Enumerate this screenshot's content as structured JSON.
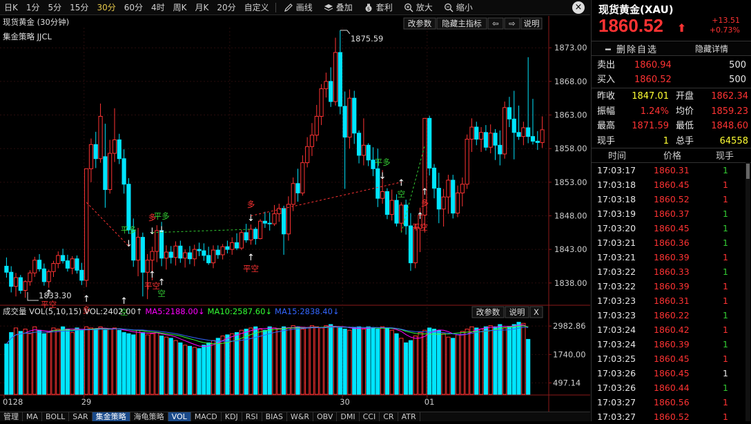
{
  "toolbar": {
    "periods": [
      "日K",
      "1分",
      "5分",
      "15分",
      "30分",
      "60分",
      "4时",
      "周K",
      "月K",
      "20分",
      "自定义"
    ],
    "active_period": "30分",
    "tools": [
      {
        "icon": "pencil-icon",
        "label": "画线"
      },
      {
        "icon": "layers-icon",
        "label": "叠加"
      },
      {
        "icon": "moneybag-icon",
        "label": "套利"
      },
      {
        "icon": "zoom-in-icon",
        "label": "放大"
      },
      {
        "icon": "zoom-out-icon",
        "label": "缩小"
      }
    ],
    "close": "×"
  },
  "main_chart": {
    "title": "现货黄金 (30分钟)",
    "indicator": "集金策略 JJCL",
    "buttons": [
      "改参数",
      "隐藏主指标",
      "⇦",
      "⇨",
      "说明"
    ],
    "high_label": "1875.59",
    "low_label": "1833.30"
  },
  "volume_panel": {
    "legend_prefix": "成交量 VOL(5,10,15)",
    "vol": "VOL:2402.00↑",
    "ma5": "MA5:2188.00↓",
    "ma10": "MA10:2587.60↓",
    "ma15": "MA15:2838.40↓",
    "buttons": [
      "改参数",
      "说明",
      "X"
    ]
  },
  "date_axis": [
    "0128",
    "29",
    "30",
    "01"
  ],
  "bottom_tabs": [
    "管理",
    "MA",
    "BOLL",
    "SAR",
    "集金策略",
    "海龟策略",
    "VOL",
    "MACD",
    "KDJ",
    "RSI",
    "BIAS",
    "W&R",
    "OBV",
    "DMI",
    "CCI",
    "CR",
    "ATR"
  ],
  "bottom_tabs_active": [
    "集金策略",
    "VOL"
  ],
  "colors": {
    "up": "#ff3333",
    "down": "#00e5ff",
    "ma5": "#ff00ff",
    "ma10": "#33ff33",
    "ma15": "#3366ff",
    "signal_buy": "#33cc33",
    "signal_sell": "#ff3333"
  },
  "quote": {
    "title": "现货黄金(XAU)",
    "price": "1860.52",
    "change": "+13.51",
    "change_pct": "+0.73%",
    "btn_delete": "删除自选",
    "btn_hide": "隐藏详情",
    "bid_label": "卖出",
    "bid": "1860.94",
    "bid_vol": "500",
    "ask_label": "买入",
    "ask": "1860.52",
    "ask_vol": "500",
    "stats": [
      {
        "l1": "昨收",
        "v1": "1847.01",
        "l2": "开盘",
        "v2": "1862.34"
      },
      {
        "l1": "振幅",
        "v1": "1.24%",
        "l2": "均价",
        "v2": "1859.23"
      },
      {
        "l1": "最高",
        "v1": "1871.59",
        "l2": "最低",
        "v2": "1848.60"
      },
      {
        "l1": "现手",
        "v1": "1",
        "l2": "总手",
        "v2": "64558"
      }
    ],
    "tick_headers": [
      "时间",
      "价格",
      "现手"
    ],
    "ticks": [
      {
        "t": "17:03:17",
        "p": "1860.31",
        "v": "1",
        "c": "green"
      },
      {
        "t": "17:03:18",
        "p": "1860.45",
        "v": "1",
        "c": "red"
      },
      {
        "t": "17:03:18",
        "p": "1860.52",
        "v": "1",
        "c": "red"
      },
      {
        "t": "17:03:19",
        "p": "1860.37",
        "v": "1",
        "c": "green"
      },
      {
        "t": "17:03:20",
        "p": "1860.45",
        "v": "1",
        "c": "green"
      },
      {
        "t": "17:03:21",
        "p": "1860.36",
        "v": "1",
        "c": "green"
      },
      {
        "t": "17:03:21",
        "p": "1860.39",
        "v": "1",
        "c": "red"
      },
      {
        "t": "17:03:22",
        "p": "1860.33",
        "v": "1",
        "c": "green"
      },
      {
        "t": "17:03:22",
        "p": "1860.39",
        "v": "1",
        "c": "red"
      },
      {
        "t": "17:03:23",
        "p": "1860.31",
        "v": "1",
        "c": "red"
      },
      {
        "t": "17:03:23",
        "p": "1860.22",
        "v": "1",
        "c": "green"
      },
      {
        "t": "17:03:24",
        "p": "1860.42",
        "v": "1",
        "c": "red"
      },
      {
        "t": "17:03:24",
        "p": "1860.39",
        "v": "1",
        "c": "green"
      },
      {
        "t": "17:03:25",
        "p": "1860.45",
        "v": "1",
        "c": "red"
      },
      {
        "t": "17:03:26",
        "p": "1860.45",
        "v": "1",
        "c": "white"
      },
      {
        "t": "17:03:26",
        "p": "1860.44",
        "v": "1",
        "c": "green"
      },
      {
        "t": "17:03:27",
        "p": "1860.56",
        "v": "1",
        "c": "red"
      },
      {
        "t": "17:03:27",
        "p": "1860.52",
        "v": "1",
        "c": "red"
      }
    ]
  },
  "chart_data": [
    {
      "type": "candlestick",
      "title": "现货黄金 (30分钟)",
      "ylim": [
        1835,
        1876
      ],
      "yticks": [
        1838.0,
        1843.0,
        1848.0,
        1853.0,
        1858.0,
        1863.0,
        1868.0,
        1873.0
      ],
      "ohlc": [
        [
          1840.5,
          1841.8,
          1838.8,
          1839.6
        ],
        [
          1839.6,
          1840.5,
          1836.6,
          1837.5
        ],
        [
          1837.5,
          1839.5,
          1836.0,
          1838.8
        ],
        [
          1838.8,
          1839.2,
          1836.4,
          1836.9
        ],
        [
          1836.9,
          1838.4,
          1835.8,
          1838.2
        ],
        [
          1838.2,
          1839.9,
          1837.6,
          1839.5
        ],
        [
          1839.5,
          1841.9,
          1838.9,
          1841.4
        ],
        [
          1841.4,
          1842.3,
          1839.7,
          1840.1
        ],
        [
          1840.1,
          1840.9,
          1837.6,
          1838.2
        ],
        [
          1838.2,
          1840.0,
          1837.3,
          1839.7
        ],
        [
          1839.7,
          1841.3,
          1838.9,
          1840.9
        ],
        [
          1840.9,
          1842.7,
          1840.2,
          1842.1
        ],
        [
          1842.1,
          1843.1,
          1840.9,
          1841.3
        ],
        [
          1841.3,
          1842.2,
          1839.7,
          1840.2
        ],
        [
          1840.2,
          1842.0,
          1839.3,
          1841.6
        ],
        [
          1841.6,
          1842.1,
          1839.4,
          1839.9
        ],
        [
          1839.9,
          1841.0,
          1837.7,
          1838.4
        ],
        [
          1838.4,
          1848.0,
          1837.4,
          1855.0
        ],
        [
          1855.0,
          1859.5,
          1853.0,
          1858.6
        ],
        [
          1858.6,
          1860.5,
          1855.1,
          1856.5
        ],
        [
          1856.5,
          1864.7,
          1855.9,
          1862.8
        ],
        [
          1856.8,
          1861.7,
          1849.2,
          1851.9
        ],
        [
          1851.9,
          1859.3,
          1851.3,
          1857.3
        ],
        [
          1857.3,
          1864.0,
          1856.0,
          1859.3
        ],
        [
          1859.3,
          1860.2,
          1855.7,
          1856.5
        ],
        [
          1856.5,
          1857.9,
          1851.3,
          1852.7
        ],
        [
          1852.7,
          1853.6,
          1845.3,
          1845.9
        ],
        [
          1845.9,
          1847.6,
          1840.4,
          1841.4
        ],
        [
          1841.4,
          1846.2,
          1839.0,
          1844.8
        ],
        [
          1844.8,
          1845.5,
          1836.0,
          1839.6
        ],
        [
          1839.6,
          1842.3,
          1835.6,
          1841.4
        ],
        [
          1841.4,
          1843.4,
          1838.4,
          1842.7
        ],
        [
          1842.7,
          1846.6,
          1841.1,
          1845.8
        ],
        [
          1845.8,
          1847.1,
          1840.5,
          1841.7
        ],
        [
          1841.7,
          1843.6,
          1840.0,
          1842.6
        ],
        [
          1842.6,
          1843.5,
          1840.9,
          1841.8
        ],
        [
          1841.8,
          1844.2,
          1840.6,
          1843.5
        ],
        [
          1843.5,
          1844.3,
          1841.0,
          1841.7
        ],
        [
          1841.7,
          1843.0,
          1840.3,
          1842.5
        ],
        [
          1842.5,
          1843.5,
          1840.8,
          1841.6
        ],
        [
          1841.6,
          1843.7,
          1840.5,
          1843.0
        ],
        [
          1843.0,
          1844.0,
          1842.0,
          1842.8
        ],
        [
          1842.8,
          1843.9,
          1841.3,
          1842.1
        ],
        [
          1842.1,
          1843.4,
          1840.7,
          1841.0
        ],
        [
          1841.0,
          1843.6,
          1840.2,
          1842.9
        ],
        [
          1842.9,
          1843.6,
          1841.6,
          1842.2
        ],
        [
          1842.2,
          1843.8,
          1841.5,
          1843.4
        ],
        [
          1843.4,
          1844.3,
          1842.4,
          1843.0
        ],
        [
          1843.0,
          1844.8,
          1842.2,
          1844.0
        ],
        [
          1844.0,
          1845.4,
          1842.9,
          1843.2
        ],
        [
          1843.2,
          1845.9,
          1842.9,
          1845.5
        ],
        [
          1845.5,
          1846.8,
          1844.0,
          1844.4
        ],
        [
          1844.4,
          1846.7,
          1843.7,
          1846.0
        ],
        [
          1846.0,
          1846.3,
          1843.7,
          1844.6
        ],
        [
          1844.6,
          1847.5,
          1844.5,
          1847.2
        ],
        [
          1847.2,
          1848.6,
          1846.2,
          1846.9
        ],
        [
          1846.9,
          1848.5,
          1845.8,
          1846.8
        ],
        [
          1846.8,
          1849.6,
          1846.5,
          1848.3
        ],
        [
          1848.3,
          1849.8,
          1847.1,
          1849.1
        ],
        [
          1849.1,
          1849.5,
          1842.2,
          1845.3
        ],
        [
          1845.3,
          1850.9,
          1844.3,
          1849.7
        ],
        [
          1849.7,
          1853.7,
          1848.7,
          1852.8
        ],
        [
          1852.8,
          1855.0,
          1850.1,
          1851.4
        ],
        [
          1851.4,
          1857.0,
          1851.0,
          1855.9
        ],
        [
          1855.9,
          1859.7,
          1855.2,
          1858.3
        ],
        [
          1858.3,
          1861.8,
          1856.9,
          1860.0
        ],
        [
          1860.0,
          1864.5,
          1859.1,
          1862.8
        ],
        [
          1862.8,
          1867.6,
          1861.5,
          1866.9
        ],
        [
          1866.9,
          1869.3,
          1865.6,
          1868.0
        ],
        [
          1868.0,
          1870.1,
          1864.2,
          1865.0
        ],
        [
          1865.0,
          1874.5,
          1864.4,
          1872.3
        ],
        [
          1872.3,
          1875.6,
          1863.1,
          1864.3
        ],
        [
          1864.3,
          1866.5,
          1852.0,
          1859.7
        ],
        [
          1859.7,
          1866.8,
          1858.0,
          1865.5
        ],
        [
          1865.5,
          1866.6,
          1858.7,
          1860.3
        ],
        [
          1860.3,
          1860.7,
          1855.8,
          1857.0
        ],
        [
          1857.0,
          1862.5,
          1855.5,
          1858.5
        ],
        [
          1858.5,
          1858.8,
          1855.4,
          1856.3
        ],
        [
          1856.3,
          1858.2,
          1853.9,
          1855.0
        ],
        [
          1855.0,
          1858.0,
          1849.3,
          1850.6
        ],
        [
          1850.6,
          1854.8,
          1849.8,
          1851.6
        ],
        [
          1851.6,
          1852.1,
          1847.5,
          1848.2
        ],
        [
          1848.2,
          1851.9,
          1847.3,
          1850.3
        ],
        [
          1850.3,
          1851.2,
          1846.4,
          1846.9
        ],
        [
          1846.9,
          1850.0,
          1845.7,
          1849.6
        ],
        [
          1849.6,
          1850.4,
          1845.2,
          1846.5
        ],
        [
          1846.5,
          1848.4,
          1839.8,
          1841.0
        ],
        [
          1841.0,
          1846.8,
          1840.2,
          1846.1
        ],
        [
          1846.1,
          1849.2,
          1842.6,
          1848.1
        ],
        [
          1848.1,
          1856.7,
          1845.5,
          1862.5
        ],
        [
          1862.5,
          1862.9,
          1854.0,
          1855.1
        ],
        [
          1855.1,
          1855.7,
          1850.6,
          1852.1
        ],
        [
          1852.1,
          1854.4,
          1846.9,
          1849.0
        ],
        [
          1849.0,
          1852.0,
          1846.4,
          1850.8
        ],
        [
          1850.8,
          1854.1,
          1848.3,
          1853.3
        ],
        [
          1853.3,
          1854.1,
          1847.6,
          1848.4
        ],
        [
          1848.4,
          1852.5,
          1847.8,
          1851.4
        ],
        [
          1851.4,
          1853.7,
          1849.4,
          1852.7
        ],
        [
          1852.7,
          1860.1,
          1852.0,
          1859.4
        ],
        [
          1859.4,
          1862.5,
          1857.5,
          1861.2
        ],
        [
          1861.2,
          1862.0,
          1858.5,
          1859.4
        ],
        [
          1859.4,
          1861.2,
          1857.5,
          1860.4
        ],
        [
          1860.4,
          1861.5,
          1857.7,
          1858.2
        ],
        [
          1858.2,
          1861.6,
          1857.3,
          1860.3
        ],
        [
          1860.3,
          1860.9,
          1856.3,
          1858.5
        ],
        [
          1858.5,
          1860.7,
          1855.5,
          1857.2
        ],
        [
          1857.2,
          1865.0,
          1856.5,
          1864.1
        ],
        [
          1864.1,
          1865.7,
          1861.2,
          1862.4
        ],
        [
          1862.4,
          1866.6,
          1856.4,
          1860.4
        ],
        [
          1860.4,
          1864.4,
          1859.3,
          1859.8
        ],
        [
          1859.8,
          1862.0,
          1858.5,
          1861.1
        ],
        [
          1861.1,
          1871.6,
          1858.8,
          1859.8
        ],
        [
          1859.8,
          1865.4,
          1858.6,
          1859.1
        ],
        [
          1859.1,
          1860.6,
          1857.8,
          1858.9
        ],
        [
          1858.9,
          1862.8,
          1858.1,
          1860.8
        ]
      ]
    },
    {
      "type": "bar",
      "title": "成交量 VOL(5,10,15)",
      "yticks": [
        497.14,
        1740.0,
        2982.86
      ],
      "ylim": [
        0,
        3350
      ],
      "values": [
        2200,
        2700,
        2900,
        2750,
        2850,
        2650,
        2950,
        2800,
        2650,
        2700,
        2900,
        2850,
        2950,
        2850,
        2700,
        2900,
        2800,
        2950,
        2900,
        2850,
        2950,
        2800,
        2850,
        2900,
        2800,
        2700,
        2650,
        2600,
        2800,
        2700,
        2600,
        2650,
        2700,
        2550,
        2500,
        2450,
        2350,
        2250,
        2150,
        2100,
        2050,
        2000,
        2150,
        2250,
        2350,
        2450,
        2550,
        2600,
        2650,
        2700,
        2800,
        2850,
        2900,
        2950,
        2850,
        2800,
        2950,
        2900,
        2850,
        2950,
        2900,
        3000,
        2950,
        2850,
        2900,
        3000,
        2950,
        2900,
        3000,
        3050,
        2950,
        2900,
        2850,
        2800,
        2900,
        2950,
        2850,
        2950,
        2900,
        2850,
        2950,
        2900,
        2800,
        2650,
        2450,
        2250,
        2350,
        2550,
        2700,
        2800,
        2900,
        2850,
        2800,
        2650,
        2500,
        2450,
        2600,
        2750,
        2850,
        2950,
        2900,
        2850,
        2950,
        3000,
        2950,
        3050,
        2900,
        2950,
        3050,
        3150,
        3100,
        2402
      ]
    }
  ]
}
